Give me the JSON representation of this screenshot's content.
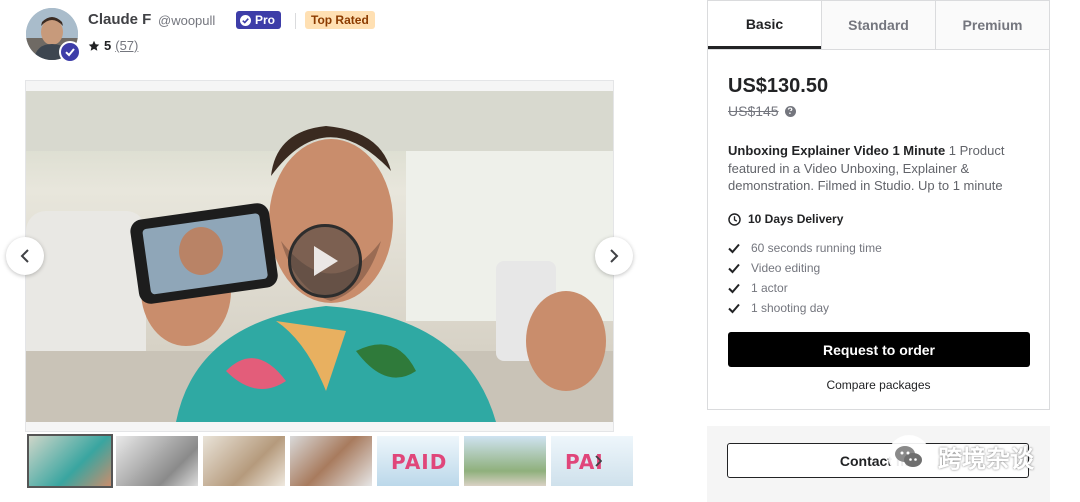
{
  "seller": {
    "name": "Claude F",
    "handle": "@woopull",
    "pro_label": "Pro",
    "top_rated_label": "Top Rated",
    "rating": "5",
    "reviews": "(57)"
  },
  "gallery": {
    "thumb_texts": [
      "",
      "",
      "",
      "",
      "PAID",
      "",
      "PAI"
    ]
  },
  "package": {
    "tabs": [
      "Basic",
      "Standard",
      "Premium"
    ],
    "active_tab": "Basic",
    "price": "US$130.50",
    "old_price": "US$145",
    "title": "Unboxing Explainer Video 1 Minute",
    "description": " 1 Product featured in a Video Unboxing, Explainer & demonstration. Filmed in Studio. Up to 1 minute",
    "delivery": "10 Days Delivery",
    "features": [
      "60 seconds running time",
      "Video editing",
      "1 actor",
      "1 shooting day"
    ],
    "order_button": "Request to order",
    "compare_link": "Compare packages",
    "contact_button": "Contact me"
  },
  "watermark": {
    "text": "跨境杂谈"
  },
  "colors": {
    "pro": "#3d3da8",
    "top_rated_bg": "#ffe0b3",
    "order_button": "#000000"
  },
  "icons": [
    "verified-badge-icon",
    "star-icon",
    "play-icon",
    "chevron-left-icon",
    "chevron-right-icon",
    "clock-icon",
    "check-icon",
    "help-icon"
  ]
}
